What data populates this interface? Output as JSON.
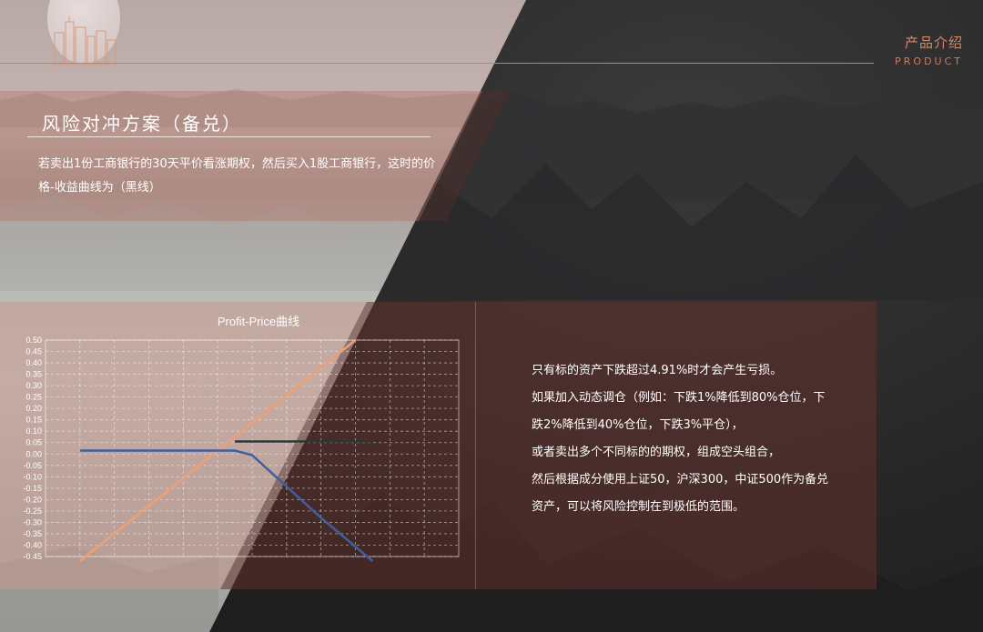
{
  "header": {
    "product_cn": "产品介绍",
    "product_en": "PRODUCT"
  },
  "section": {
    "title": "风险对冲方案（备兑）",
    "description": "若卖出1份工商银行的30天平价看涨期权，然后买入1股工商银行，这时的价格-收益曲线为（黑线）"
  },
  "info": {
    "paragraphs": [
      "只有标的资产下跌超过4.91%时才会产生亏损。",
      "如果加入动态调仓（例如：下跌1%降低到80%仓位，下跌2%降低到40%仓位，下跌3%平仓），",
      "或者卖出多个不同标的的期权，组成空头组合，",
      "然后根据成分使用上证50，沪深300，中证500作为备兑资产，可以将风险控制在到极低的范围。"
    ]
  },
  "colors": {
    "accent": "#c97e60",
    "stock_line": "#f0a070",
    "option_line": "#3f5f9f",
    "combined_line": "#333333"
  },
  "chart_data": {
    "type": "line",
    "title": "Profit-Price曲线",
    "xlabel": "",
    "ylabel": "",
    "ylim": [
      -0.45,
      0.5
    ],
    "y_ticks": [
      "0.50",
      "0.45",
      "0.40",
      "0.35",
      "0.30",
      "0.25",
      "0.20",
      "0.15",
      "0.10",
      "0.05",
      "0.00",
      "-0.05",
      "-0.10",
      "-0.15",
      "-0.20",
      "-0.25",
      "-0.30",
      "-0.35",
      "-0.40",
      "-0.45"
    ],
    "x_range": [
      0,
      12
    ],
    "grid": true,
    "series": [
      {
        "color": "#f0a070",
        "x": [
          1,
          9
        ],
        "y": [
          -0.47,
          0.5
        ]
      },
      {
        "color": "#3f5f9f",
        "x": [
          1,
          5.5,
          6,
          8,
          9.5
        ],
        "y": [
          0.015,
          0.015,
          -0.005,
          -0.28,
          -0.47
        ]
      },
      {
        "color": "#333333",
        "x": [
          5.5,
          9.5
        ],
        "y": [
          0.055,
          0.055
        ]
      }
    ]
  }
}
